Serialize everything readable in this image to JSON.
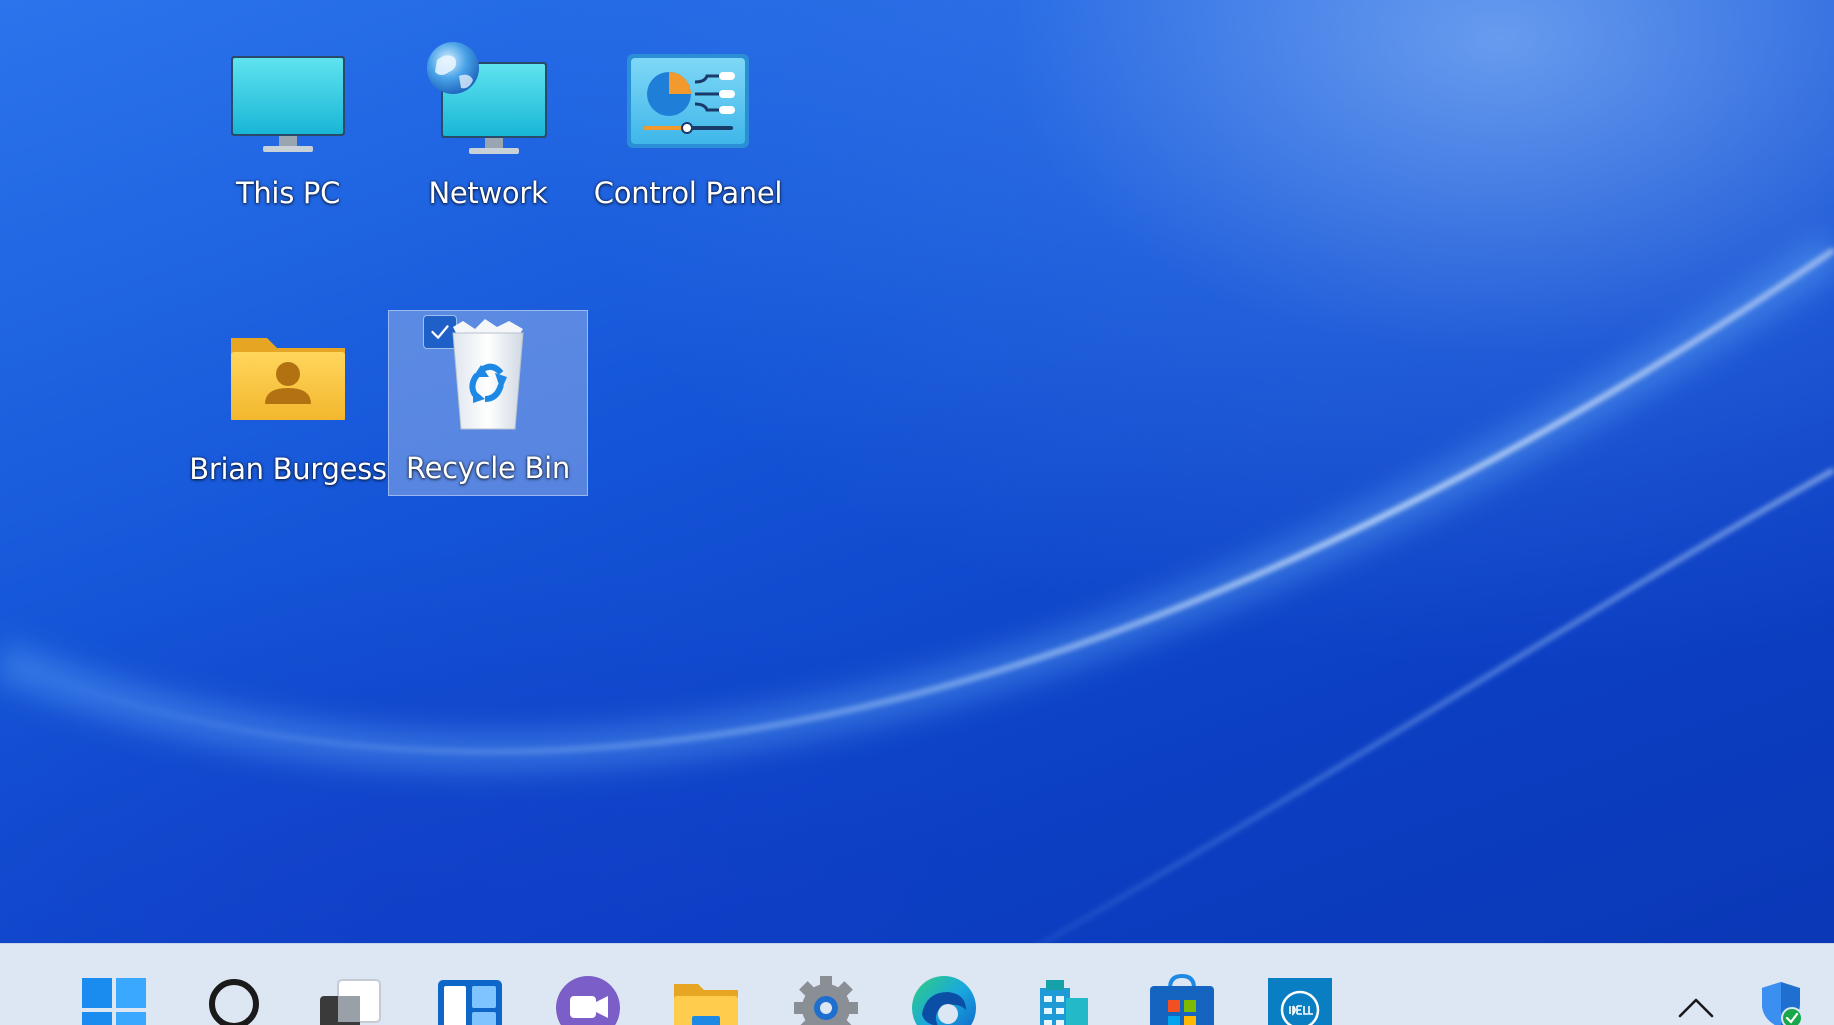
{
  "desktop": {
    "icons": [
      {
        "label": "This PC",
        "icon": "computer-icon"
      },
      {
        "label": "Network",
        "icon": "network-icon"
      },
      {
        "label": "Control Panel",
        "icon": "control-panel-icon"
      },
      {
        "label": "Brian Burgess",
        "icon": "user-folder-icon"
      },
      {
        "label": "Recycle Bin",
        "icon": "recycle-bin-icon",
        "selected": true
      }
    ]
  },
  "taskbar": {
    "items": [
      {
        "name": "Start",
        "icon": "windows-start-icon"
      },
      {
        "name": "Search",
        "icon": "search-icon"
      },
      {
        "name": "Task View",
        "icon": "task-view-icon"
      },
      {
        "name": "Widgets",
        "icon": "widgets-icon"
      },
      {
        "name": "Chat",
        "icon": "teams-chat-icon"
      },
      {
        "name": "File Explorer",
        "icon": "file-explorer-icon"
      },
      {
        "name": "Settings",
        "icon": "settings-gear-icon"
      },
      {
        "name": "Microsoft Edge",
        "icon": "edge-icon"
      },
      {
        "name": "Office",
        "icon": "building-app-icon"
      },
      {
        "name": "Microsoft Store",
        "icon": "store-icon"
      },
      {
        "name": "Dell",
        "icon": "dell-icon"
      }
    ],
    "tray": [
      {
        "name": "Show hidden icons",
        "icon": "chevron-up-icon"
      },
      {
        "name": "Windows Security",
        "icon": "security-shield-icon"
      }
    ]
  },
  "colors": {
    "taskbar_bg": "#dde6f3",
    "desktop_blue": "#1556d8",
    "selection": "#b4c8eb"
  }
}
